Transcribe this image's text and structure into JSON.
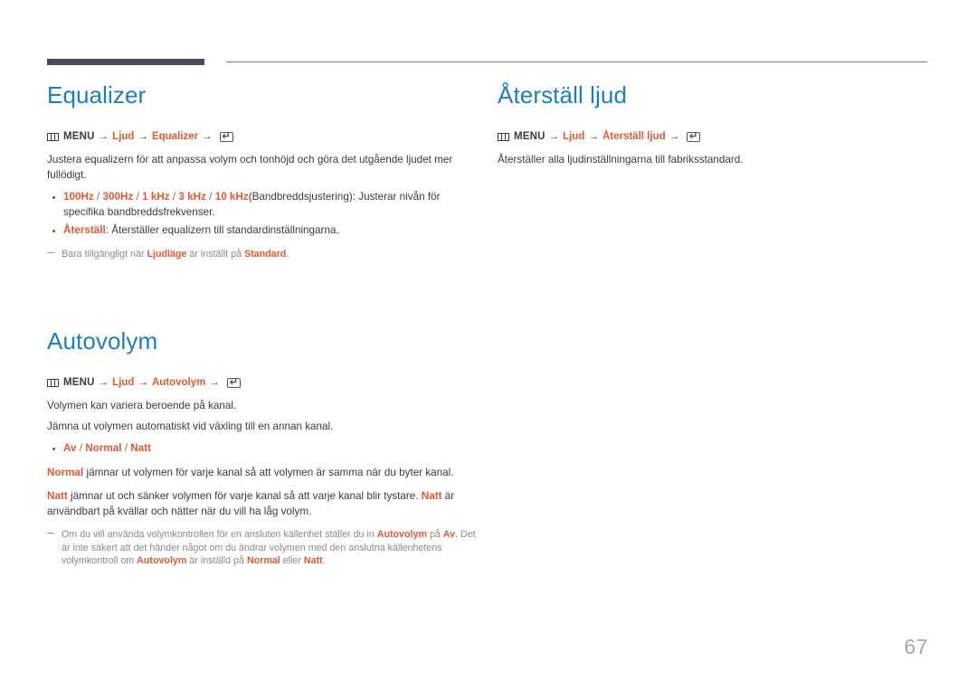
{
  "page": {
    "number": "67",
    "accent_blue": "#1a7fc1",
    "accent_orange": "#e05a36",
    "rule_color": "#474a5e"
  },
  "icons": {
    "menu": "menu-grid-icon",
    "enter": "enter-key-icon",
    "enter_glyph": "↵",
    "arrow_glyph": "→"
  },
  "sections": {
    "equalizer": {
      "title": "Equalizer",
      "menu_path": {
        "menu_label": "MENU",
        "step1": "Ljud",
        "step2": "Equalizer"
      },
      "intro": "Justera equalizern för att anpassa volym och tonhöjd och göra det utgående ljudet mer fullödigt.",
      "bullets": [
        {
          "options": [
            "100Hz",
            "300Hz",
            "1 kHz",
            "3 kHz",
            "10 kHz"
          ],
          "tail": "(Bandbreddsjustering): Justerar nivån för specifika bandbreddsfrekvenser."
        },
        {
          "label": "Återställ",
          "tail": ": Återställer equalizern till standardinställningarna."
        }
      ],
      "note": {
        "pre": "Bara tillgängligt när ",
        "hl1": "Ljudläge",
        "mid": " är inställt på ",
        "hl2": "Standard",
        "post": "."
      }
    },
    "autovolym": {
      "title": "Autovolym",
      "menu_path": {
        "menu_label": "MENU",
        "step1": "Ljud",
        "step2": "Autovolym"
      },
      "para1": "Volymen kan variera beroende på kanal.",
      "para2": "Jämna ut volymen automatiskt vid växling till en annan kanal.",
      "bullet_options": [
        "Av",
        "Normal",
        "Natt"
      ],
      "para3": {
        "hl": "Normal",
        "text": " jämnar ut volymen för varje kanal så att volymen är samma när du byter kanal."
      },
      "para4": {
        "hl1": "Natt",
        "text1": " jämnar ut och sänker volymen för varje kanal så att varje kanal blir tystare. ",
        "hl2": "Natt",
        "text2": " är användbart på kvällar och nätter när du vill ha låg volym."
      },
      "note": {
        "t1": "Om du vill använda volymkontrollen för en ansluten källenhet ställer du in ",
        "h1": "Autovolym",
        "t2": " på ",
        "h2": "Av",
        "t3": ". Det är inte säkert att det händer något om du ändrar volymen med den anslutna källenhetens volymkontroll om ",
        "h3": "Autovolym",
        "t4": " är inställd på ",
        "h4": "Normal",
        "t5": " eller ",
        "h5": "Natt",
        "t6": "."
      }
    },
    "aterstall_ljud": {
      "title": "Återställ ljud",
      "menu_path": {
        "menu_label": "MENU",
        "step1": "Ljud",
        "step2": "Återställ ljud"
      },
      "body": "Återställer alla ljudinställningarna till fabriksstandard."
    }
  }
}
